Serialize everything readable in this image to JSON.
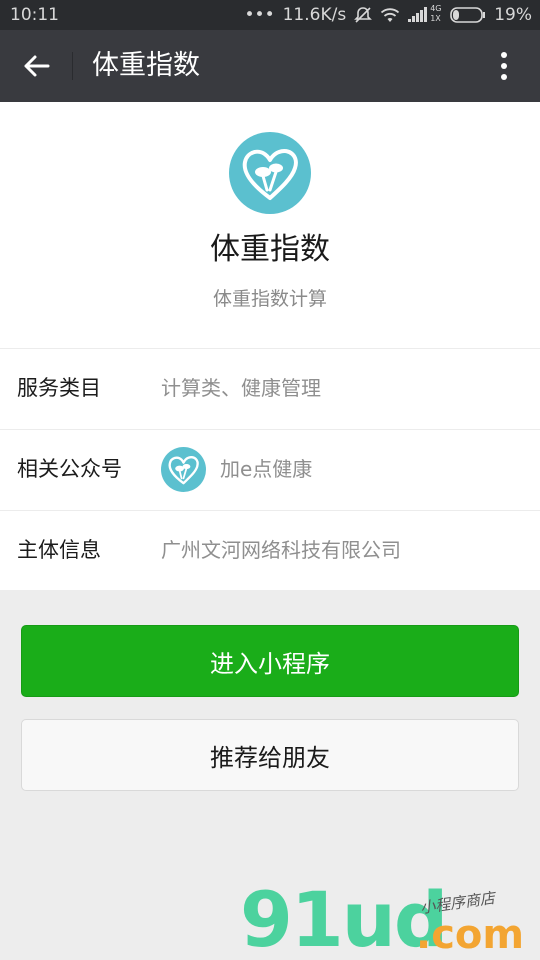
{
  "status_bar": {
    "time": "10:11",
    "dots": "•••",
    "speed": "11.6K/s",
    "network_top": "4G",
    "network_bottom": "1X",
    "battery": "19%"
  },
  "app_bar": {
    "title": "体重指数",
    "back_icon": "arrow-left-icon",
    "more_icon": "more-vertical-icon"
  },
  "profile": {
    "name": "体重指数",
    "description": "体重指数计算",
    "logo_color": "#5bc0cf"
  },
  "info": {
    "category_label": "服务类目",
    "category_value": "计算类、健康管理",
    "account_label": "相关公众号",
    "account_value": "加e点健康",
    "entity_label": "主体信息",
    "entity_value": "广州文河网络科技有限公司"
  },
  "buttons": {
    "enter": "进入小程序",
    "recommend": "推荐给朋友",
    "primary_color": "#1aad19"
  },
  "watermark": {
    "main": "91ud",
    "suffix": ".com",
    "tagline": "小程序商店"
  }
}
